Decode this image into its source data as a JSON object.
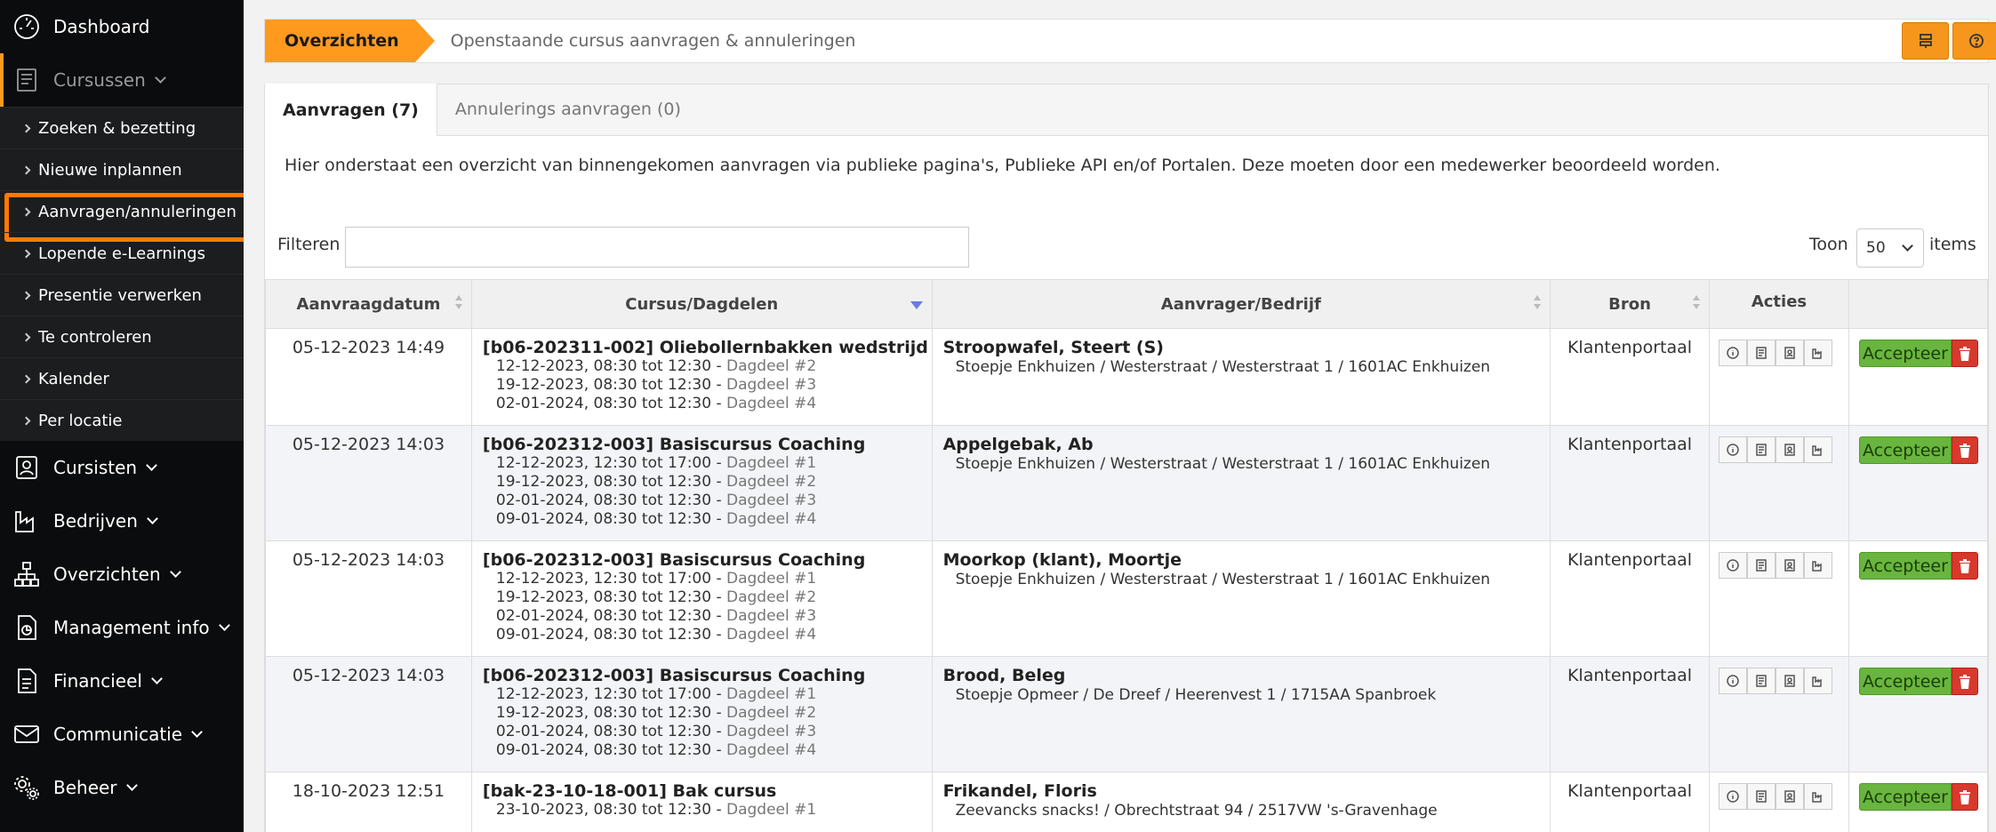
{
  "sidebar": {
    "items": [
      {
        "label": "Dashboard",
        "icon": "dashboard-icon",
        "chevron": false
      },
      {
        "label": "Cursussen",
        "icon": "book-icon",
        "chevron": true,
        "active": true
      },
      {
        "label": "Cursisten",
        "icon": "person-card-icon",
        "chevron": true
      },
      {
        "label": "Bedrijven",
        "icon": "factory-icon",
        "chevron": true
      },
      {
        "label": "Overzichten",
        "icon": "sitemap-icon",
        "chevron": true
      },
      {
        "label": "Management info",
        "icon": "report-icon",
        "chevron": true
      },
      {
        "label": "Financieel",
        "icon": "document-icon",
        "chevron": true
      },
      {
        "label": "Communicatie",
        "icon": "envelope-icon",
        "chevron": true
      },
      {
        "label": "Beheer",
        "icon": "gears-icon",
        "chevron": true
      }
    ],
    "subitems": [
      "Zoeken & bezetting",
      "Nieuwe inplannen",
      "Aanvragen/annuleringen",
      "Lopende e-Learnings",
      "Presentie verwerken",
      "Te controleren",
      "Kalender",
      "Per locatie"
    ]
  },
  "breadcrumb": {
    "active": "Overzichten",
    "current": "Openstaande cursus aanvragen & annuleringen"
  },
  "tabs": [
    "Aanvragen (7)",
    "Annulerings aanvragen (0)"
  ],
  "intro": "Hier onderstaat een overzicht van binnengekomen aanvragen via publieke pagina's, Publieke API en/of Portalen. Deze moeten door een medewerker beoordeeld worden.",
  "filter": {
    "label": "Filteren",
    "value": ""
  },
  "pager": {
    "toon": "Toon",
    "count": "50",
    "items": "items"
  },
  "table": {
    "headers": [
      "Aanvraagdatum",
      "Cursus/Dagdelen",
      "Aanvrager/Bedrijf",
      "Bron",
      "Acties"
    ],
    "accept_label": "Accepteer",
    "rows": [
      {
        "date": "05-12-2023 14:49",
        "course": "[b06-202311-002] Oliebollernbakken wedstrijd",
        "parts": [
          {
            "time": "12-12-2023, 08:30 tot 12:30 -",
            "dag": "Dagdeel #2"
          },
          {
            "time": "19-12-2023, 08:30 tot 12:30 -",
            "dag": "Dagdeel #3"
          },
          {
            "time": "02-01-2024, 08:30 tot 12:30 -",
            "dag": "Dagdeel #4"
          }
        ],
        "name": "Stroopwafel, Steert (S)",
        "address": "Stoepje Enkhuizen / Westerstraat / Westerstraat 1 / 1601AC Enkhuizen",
        "bron": "Klantenportaal"
      },
      {
        "date": "05-12-2023 14:03",
        "course": "[b06-202312-003] Basiscursus Coaching",
        "parts": [
          {
            "time": "12-12-2023, 12:30 tot 17:00 -",
            "dag": "Dagdeel #1"
          },
          {
            "time": "19-12-2023, 08:30 tot 12:30 -",
            "dag": "Dagdeel #2"
          },
          {
            "time": "02-01-2024, 08:30 tot 12:30 -",
            "dag": "Dagdeel #3"
          },
          {
            "time": "09-01-2024, 08:30 tot 12:30 -",
            "dag": "Dagdeel #4"
          }
        ],
        "name": "Appelgebak, Ab",
        "address": "Stoepje Enkhuizen / Westerstraat / Westerstraat 1 / 1601AC Enkhuizen",
        "bron": "Klantenportaal"
      },
      {
        "date": "05-12-2023 14:03",
        "course": "[b06-202312-003] Basiscursus Coaching",
        "parts": [
          {
            "time": "12-12-2023, 12:30 tot 17:00 -",
            "dag": "Dagdeel #1"
          },
          {
            "time": "19-12-2023, 08:30 tot 12:30 -",
            "dag": "Dagdeel #2"
          },
          {
            "time": "02-01-2024, 08:30 tot 12:30 -",
            "dag": "Dagdeel #3"
          },
          {
            "time": "09-01-2024, 08:30 tot 12:30 -",
            "dag": "Dagdeel #4"
          }
        ],
        "name": "Moorkop (klant), Moortje",
        "address": "Stoepje Enkhuizen / Westerstraat / Westerstraat 1 / 1601AC Enkhuizen",
        "bron": "Klantenportaal"
      },
      {
        "date": "05-12-2023 14:03",
        "course": "[b06-202312-003] Basiscursus Coaching",
        "parts": [
          {
            "time": "12-12-2023, 12:30 tot 17:00 -",
            "dag": "Dagdeel #1"
          },
          {
            "time": "19-12-2023, 08:30 tot 12:30 -",
            "dag": "Dagdeel #2"
          },
          {
            "time": "02-01-2024, 08:30 tot 12:30 -",
            "dag": "Dagdeel #3"
          },
          {
            "time": "09-01-2024, 08:30 tot 12:30 -",
            "dag": "Dagdeel #4"
          }
        ],
        "name": "Brood, Beleg",
        "address": "Stoepje Opmeer / De Dreef / Heerenvest 1 / 1715AA Spanbroek",
        "bron": "Klantenportaal"
      },
      {
        "date": "18-10-2023 12:51",
        "course": "[bak-23-10-18-001] Bak cursus",
        "parts": [
          {
            "time": "23-10-2023, 08:30 tot 12:30 -",
            "dag": "Dagdeel #1"
          }
        ],
        "name": "Frikandel, Floris",
        "address": "Zeevancks snacks! / Obrechtstraat 94 / 2517VW 's-Gravenhage",
        "bron": "Klantenportaal"
      }
    ]
  },
  "colors": {
    "accent": "#ff9a1f",
    "sidebar_bg": "#0b0c0d",
    "accept": "#69b53f",
    "delete": "#d9382c",
    "highlight": "#ff7a00"
  }
}
